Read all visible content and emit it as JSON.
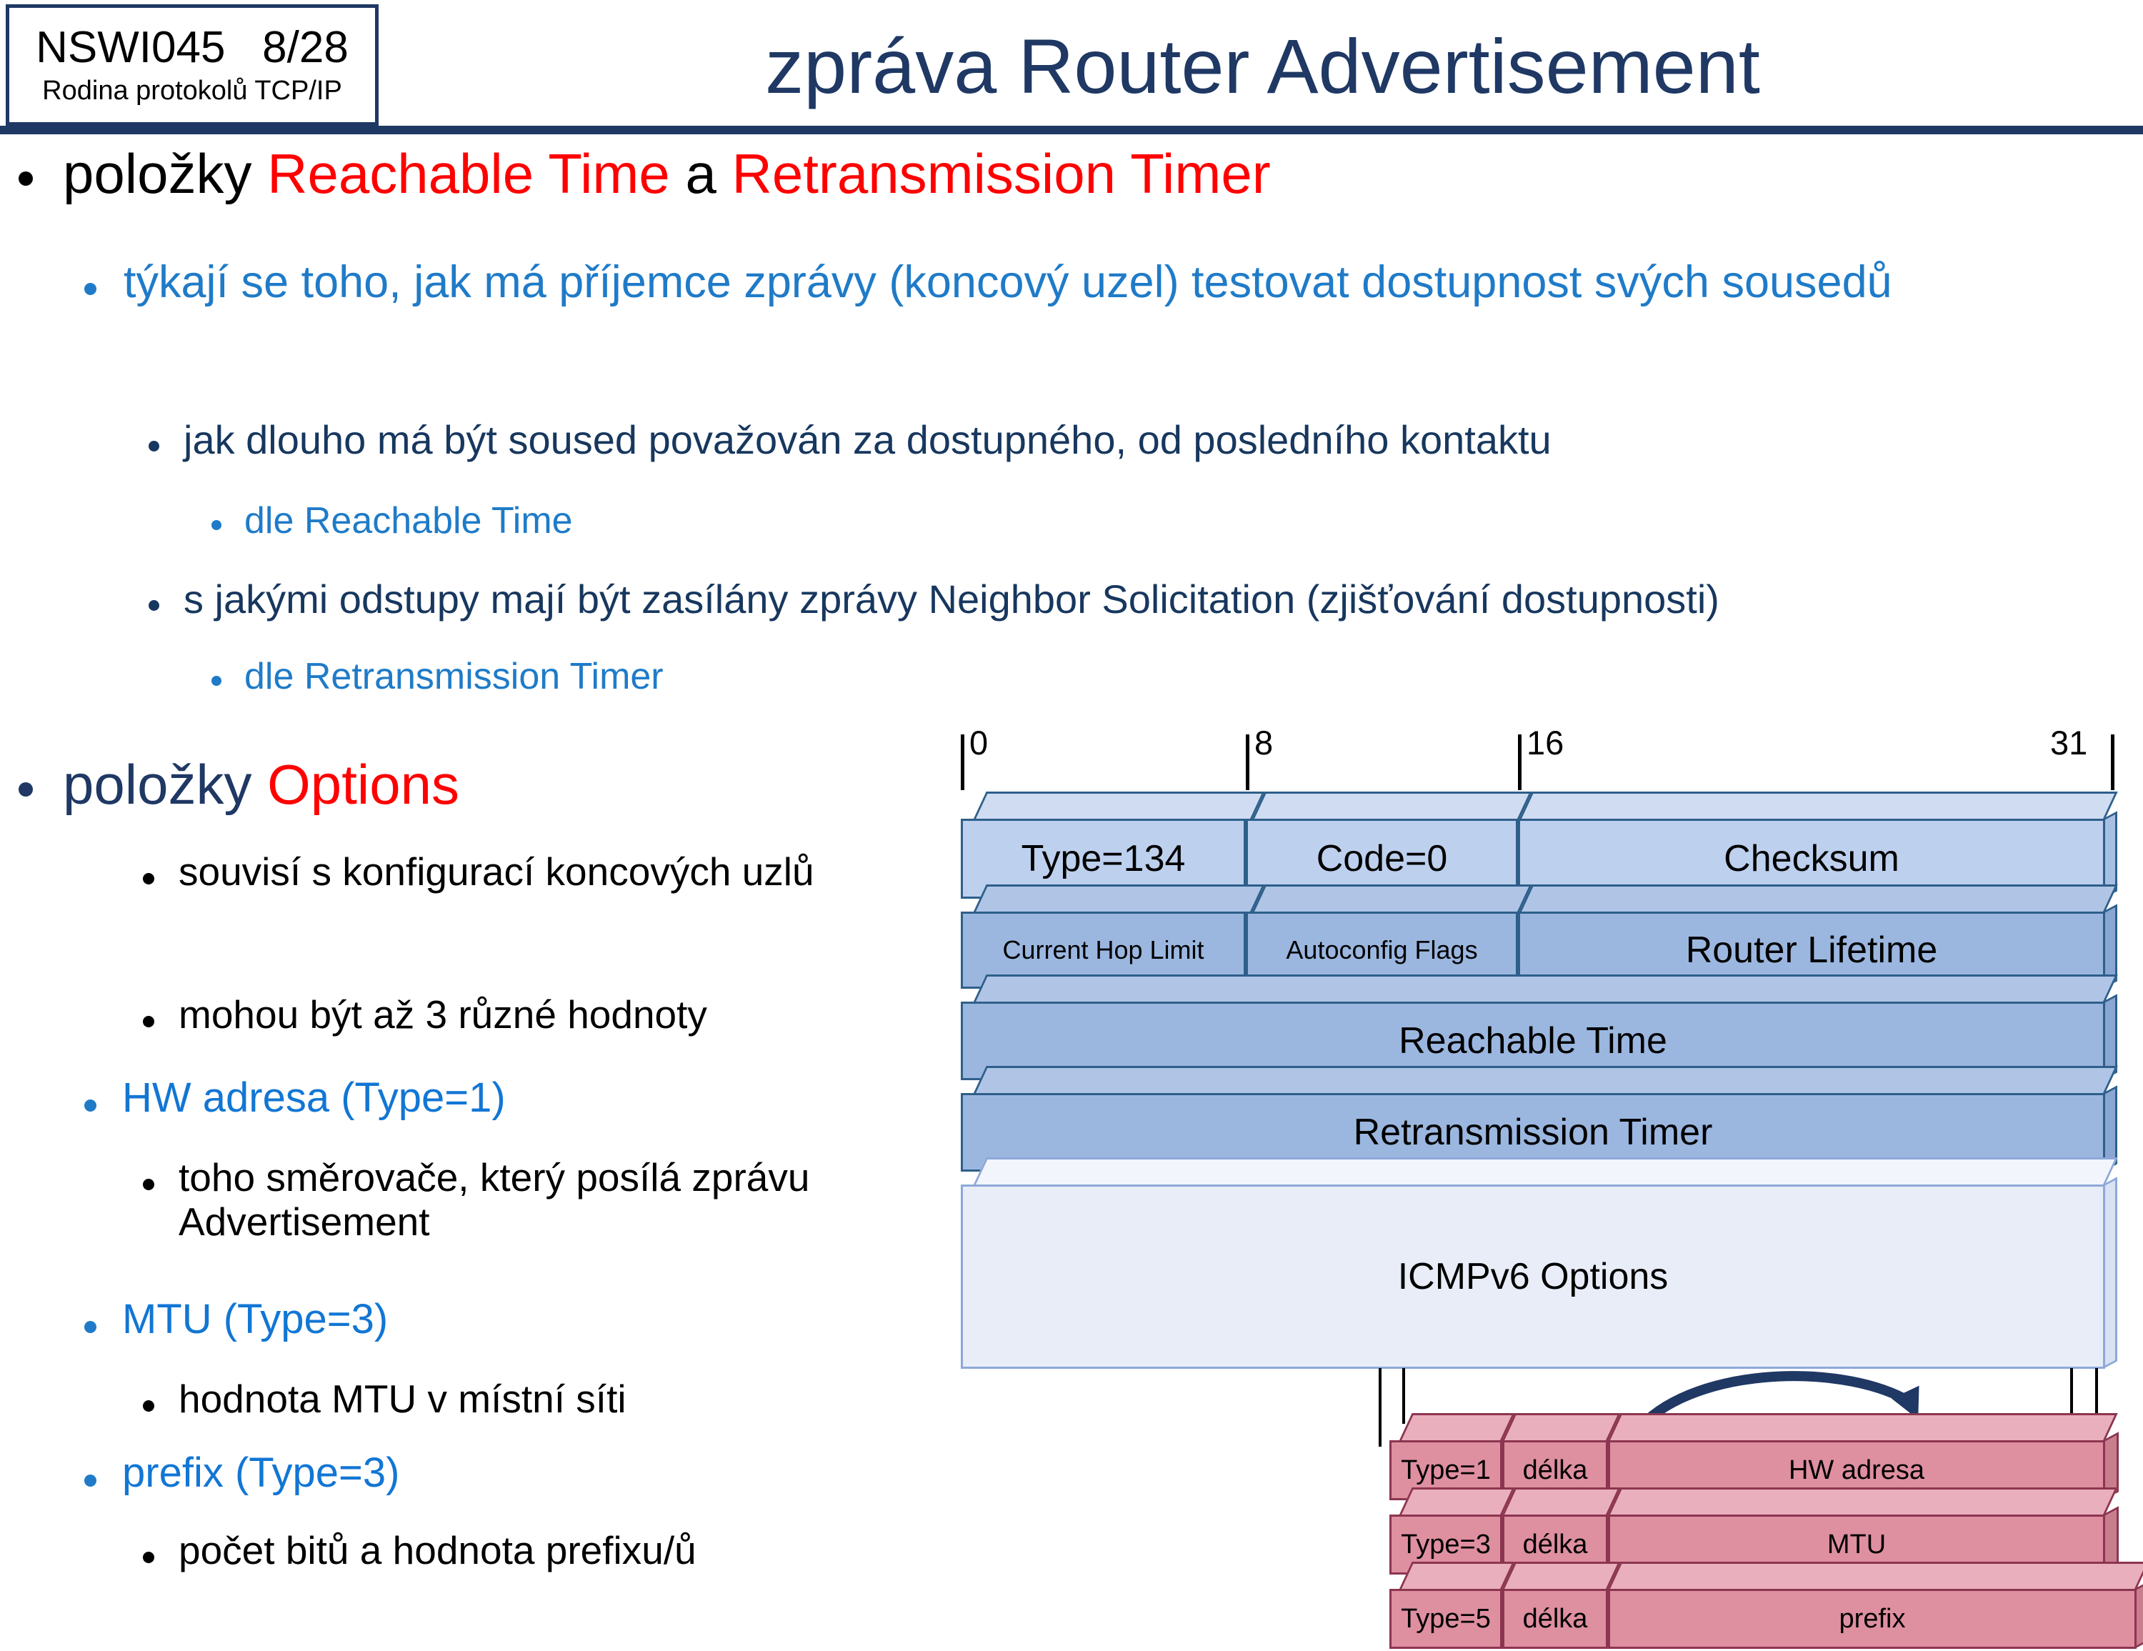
{
  "header": {
    "course_code": "NSWI045   8/28",
    "course_subtitle": "Rodina protokolů TCP/IP",
    "title": "zpráva Router Advertisement"
  },
  "colors": {
    "navy": "#1F3864",
    "red": "#FF0000",
    "blue_mid": "#1F7BC8",
    "blue_dark": "#17375E",
    "header_rule": "#1F3864",
    "pkt_light": "#BDD0EE",
    "pkt_mid": "#9BB7E0",
    "pkt_options": "#E8EDF7",
    "opt_pink": "#DE8FA0",
    "arrow": "#1F3864"
  },
  "bullets": {
    "b1_pre": "položky ",
    "b1_red1": "Reachable Time",
    "b1_mid": " a ",
    "b1_red2": "Retransmission Timer",
    "b2": "týkají se toho, jak má příjemce zprávy (koncový uzel) testovat dostupnost svých sousedů",
    "b3a": "jak dlouho má být soused považován za dostupného, od posledního kontaktu",
    "b4a": "dle Reachable Time",
    "b3b": "s jakými odstupy mají být zasílány zprávy Neighbor Solicitation (zjišťování dostupnosti)",
    "b4b": "dle Retransmission Timer",
    "o1_pre": "položky ",
    "o1_red": "Options",
    "o2a": "souvisí s konfigurací koncových uzlů",
    "o2b": "mohou být až 3 různé hodnoty",
    "o3a": "HW adresa (Type=1)",
    "o4a": "toho směrovače, který posílá zprávu Advertisement",
    "o3b": "MTU (Type=3)",
    "o4b": "hodnota MTU v místní síti",
    "o3c": "prefix (Type=3)",
    "o4c": "počet bitů a hodnota prefixu/ů"
  },
  "diagram": {
    "ruler": {
      "ticks": [
        "0",
        "8",
        "16",
        "31"
      ]
    },
    "rows": [
      {
        "cells": [
          "Type=134",
          "Code=0",
          "Checksum"
        ]
      },
      {
        "cells": [
          "Current Hop Limit",
          "Autoconfig Flags",
          "Router Lifetime"
        ]
      },
      {
        "cells": [
          "Reachable Time"
        ]
      },
      {
        "cells": [
          "Retransmission Timer"
        ]
      },
      {
        "cells": [
          "ICMPv6 Options"
        ]
      }
    ],
    "options": [
      {
        "type": "Type=1",
        "len": "délka",
        "value": "HW adresa"
      },
      {
        "type": "Type=3",
        "len": "délka",
        "value": "MTU"
      },
      {
        "type": "Type=5",
        "len": "délka",
        "value": "prefix"
      }
    ]
  }
}
